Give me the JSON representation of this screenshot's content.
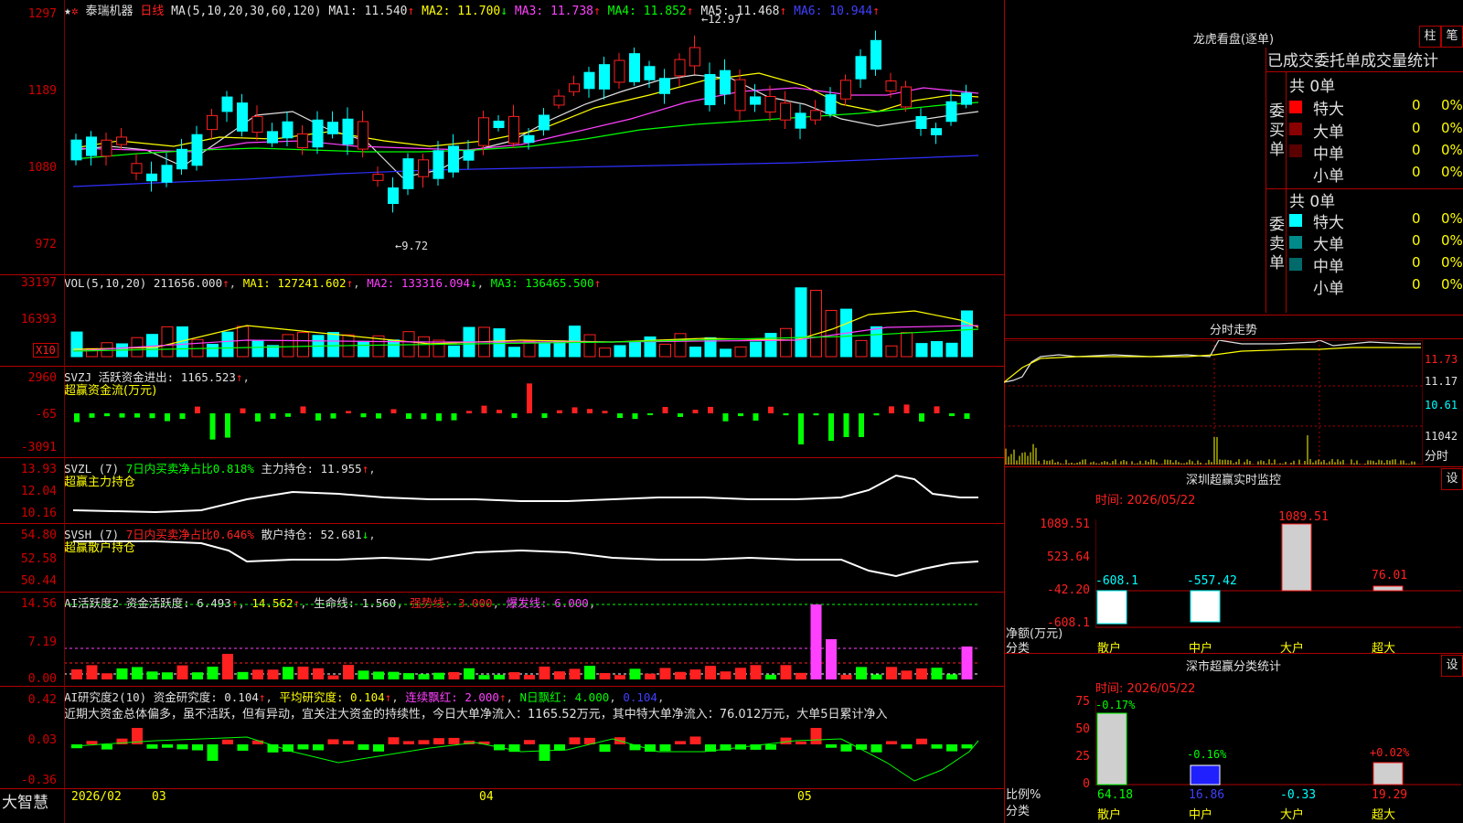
{
  "stock": {
    "name": "泰瑞机器",
    "period": "日线",
    "ma_header": "MA(5,10,20,30,60,120)",
    "ma1": "MA1: 11.540",
    "ma2": "MA2: 11.700",
    "ma3": "MA3: 11.738",
    "ma4": "MA4: 11.852",
    "ma5": "MA5: 11.468",
    "ma6": "MA6: 10.944",
    "high_label": "12.97",
    "low_label": "9.72",
    "price_axis": [
      "1297",
      "1189",
      "1080",
      "972"
    ]
  },
  "vol": {
    "header": "VOL(5,10,20)",
    "value": "211656.000",
    "ma1": "MA1: 127241.602",
    "ma2": "MA2: 133316.094",
    "ma3": "MA3: 136465.500",
    "axis": [
      "33197",
      "16393"
    ],
    "unit": "X10"
  },
  "svzj": {
    "header": "SVZJ",
    "label": "活跃资金进出: 1165.523",
    "subtitle": "超赢资金流(万元)",
    "axis": [
      "2960",
      "-65",
      "-3091"
    ]
  },
  "svzl": {
    "header": "SVZL (7)",
    "ratio": "7日内买卖净占比0.818%",
    "hold": "主力持仓: 11.955",
    "subtitle": "超赢主力持仓",
    "axis": [
      "13.93",
      "12.04",
      "10.16"
    ]
  },
  "svsh": {
    "header": "SVSH (7)",
    "ratio": "7日内买卖净占比0.646%",
    "hold": "散户持仓: 52.681",
    "subtitle": "超赢散户持仓",
    "axis": [
      "54.80",
      "52.58",
      "50.44"
    ]
  },
  "ai1": {
    "header": "AI活跃度2 资金活跃度: 6.493",
    "v1": "14.562",
    "life": "生命线: 1.560",
    "strong": "强势线: 3.000",
    "burst": "爆发线: 6.000",
    "axis": [
      "14.56",
      "7.19",
      "0.00"
    ]
  },
  "ai2": {
    "header": "AI研究度2(10) 资金研究度: 0.104",
    "avg": "平均研究度: 0.104",
    "cont": "连续飘红: 2.000",
    "nred": "N日飘红: 4.000",
    "last": "0.104",
    "text": "近期大资金总体偏多，虽不活跃，但有异动，宜关注大资金的持续性，今日大单净流入：1165.52万元，其中特大单净流入：76.012万元，大单5日累计净入",
    "axis": [
      "0.42",
      "0.03",
      "-0.36"
    ]
  },
  "time_axis": {
    "app": "大智慧",
    "labels": [
      "2026/02",
      "03",
      "04",
      "05"
    ]
  },
  "lhb": {
    "title": "龙虎看盘(逐单)",
    "btn_zhu": "柱",
    "btn_bi": "笔",
    "tabs": "已成交委托单成交量统计",
    "buy_label": "委买单",
    "sell_label": "委卖单",
    "buy_total": "共 0单",
    "sell_total": "共 0单",
    "rows": [
      {
        "name": "特大",
        "n": "0",
        "p": "0%"
      },
      {
        "name": "大单",
        "n": "0",
        "p": "0%"
      },
      {
        "name": "中单",
        "n": "0",
        "p": "0%"
      },
      {
        "name": "小单",
        "n": "0",
        "p": "0%"
      }
    ]
  },
  "intraday": {
    "title": "分时走势",
    "axis": [
      "11.73",
      "11.17",
      "10.61",
      "11042",
      "分时"
    ]
  },
  "sz_monitor": {
    "title": "深圳超赢实时监控",
    "btn": "设",
    "time": "时间: 2026/05/22",
    "axis": [
      "1089.51",
      "523.64",
      "-42.20",
      "-608.1"
    ],
    "net_label": "净额(万元)",
    "cat_label": "分类",
    "categories": [
      "散户",
      "中户",
      "大户",
      "超大"
    ],
    "values": [
      "-608.1",
      "-557.42",
      "1089.51",
      "76.01"
    ]
  },
  "sz_class": {
    "title": "深市超赢分类统计",
    "btn": "设",
    "time": "时间: 2026/05/22",
    "axis": [
      "75",
      "50",
      "25",
      "0"
    ],
    "ratio_label": "比例%",
    "cat_label": "分类",
    "categories": [
      "散户",
      "中户",
      "大户",
      "超大"
    ],
    "changes": [
      "-0.17%",
      "-0.16%",
      "",
      "+0.02%"
    ],
    "values": [
      "64.18",
      "16.86",
      "-0.33",
      "19.29"
    ]
  }
}
